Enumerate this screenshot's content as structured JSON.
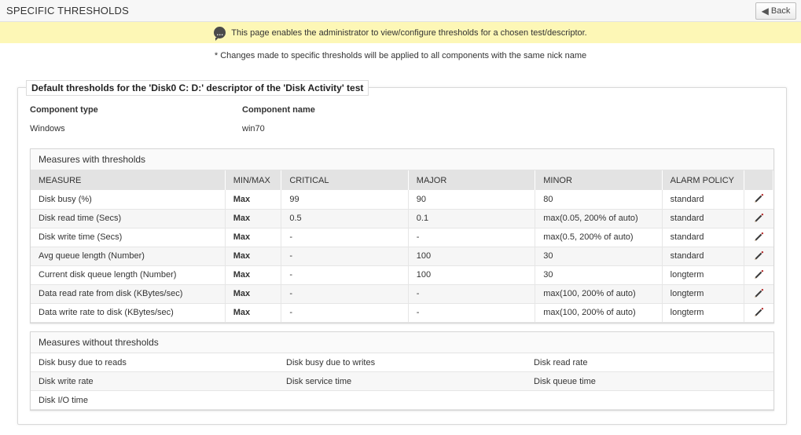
{
  "header": {
    "title": "SPECIFIC THRESHOLDS",
    "back_label": "Back"
  },
  "info": {
    "message": "This page enables the administrator to view/configure thresholds for a chosen test/descriptor.",
    "note": "* Changes made to specific thresholds will be applied to all components with the same nick name"
  },
  "panel": {
    "legend": "Default thresholds for the 'Disk0 C: D:' descriptor of the 'Disk Activity' test",
    "component_type_label": "Component type",
    "component_type_value": "Windows",
    "component_name_label": "Component name",
    "component_name_value": "win70"
  },
  "with_thresholds": {
    "title": "Measures with thresholds",
    "columns": [
      "MEASURE",
      "MIN/MAX",
      "CRITICAL",
      "MAJOR",
      "MINOR",
      "ALARM POLICY"
    ],
    "rows": [
      {
        "measure": "Disk busy (%)",
        "minmax": "Max",
        "critical": "99",
        "major": "90",
        "minor": "80",
        "policy": "standard"
      },
      {
        "measure": "Disk read time (Secs)",
        "minmax": "Max",
        "critical": "0.5",
        "major": "0.1",
        "minor": "max(0.05, 200% of auto)",
        "policy": "standard"
      },
      {
        "measure": "Disk write time (Secs)",
        "minmax": "Max",
        "critical": "-",
        "major": "-",
        "minor": "max(0.5, 200% of auto)",
        "policy": "standard"
      },
      {
        "measure": "Avg queue length (Number)",
        "minmax": "Max",
        "critical": "-",
        "major": "100",
        "minor": "30",
        "policy": "standard"
      },
      {
        "measure": "Current disk queue length (Number)",
        "minmax": "Max",
        "critical": "-",
        "major": "100",
        "minor": "30",
        "policy": "longterm"
      },
      {
        "measure": "Data read rate from disk (KBytes/sec)",
        "minmax": "Max",
        "critical": "-",
        "major": "-",
        "minor": "max(100, 200% of auto)",
        "policy": "longterm"
      },
      {
        "measure": "Data write rate to disk (KBytes/sec)",
        "minmax": "Max",
        "critical": "-",
        "major": "-",
        "minor": "max(100, 200% of auto)",
        "policy": "longterm"
      }
    ]
  },
  "without_thresholds": {
    "title": "Measures without thresholds",
    "items": [
      "Disk busy due to reads",
      "Disk busy due to writes",
      "Disk read rate",
      "Disk write rate",
      "Disk service time",
      "Disk queue time",
      "Disk I/O time",
      "",
      ""
    ]
  },
  "icons": {
    "back": "back-arrow-icon",
    "info": "speech-bubble-icon",
    "edit": "pencil-icon"
  },
  "colors": {
    "info_bar": "#fdf7b6",
    "table_header": "#e3e3e3"
  }
}
